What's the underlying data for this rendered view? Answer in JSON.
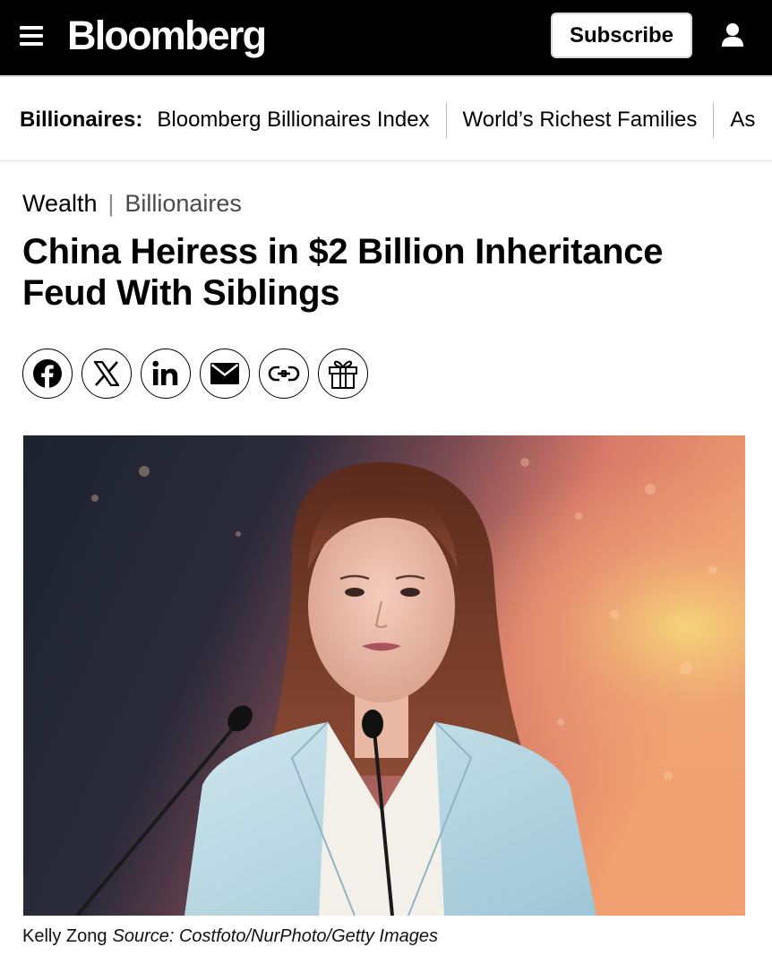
{
  "header": {
    "logo": "Bloomberg",
    "subscribe_label": "Subscribe",
    "background": "#000000"
  },
  "subnav": {
    "label": "Billionaires:",
    "links": [
      "Bloomberg Billionaires Index",
      "World’s Richest Families",
      "As"
    ]
  },
  "breadcrumb": {
    "section": "Wealth",
    "separator": "|",
    "subsection": "Billionaires"
  },
  "article": {
    "headline": "China Heiress in $2 Billion Inheritance Feud With Siblings"
  },
  "share": {
    "icons": [
      "facebook-icon",
      "x-icon",
      "linkedin-icon",
      "email-icon",
      "link-icon",
      "gift-icon"
    ]
  },
  "hero": {
    "caption_name": "Kelly Zong",
    "caption_source": "Source: Costfoto/NurPhoto/Getty Images"
  }
}
